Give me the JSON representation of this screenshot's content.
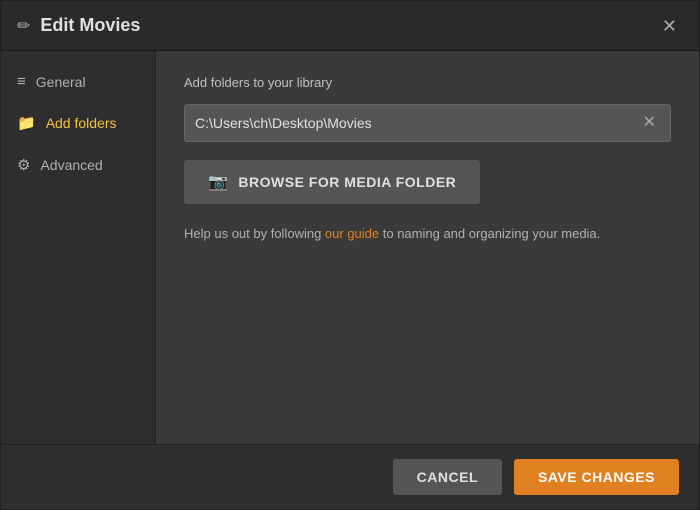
{
  "dialog": {
    "title": "Edit Movies",
    "title_icon": "✏",
    "close_icon": "✕"
  },
  "sidebar": {
    "items": [
      {
        "id": "general",
        "label": "General",
        "icon": "≡",
        "active": false
      },
      {
        "id": "add-folders",
        "label": "Add folders",
        "icon": "📁",
        "active": true
      },
      {
        "id": "advanced",
        "label": "Advanced",
        "icon": "⚙",
        "active": false
      }
    ]
  },
  "main": {
    "section_label": "Add folders to your library",
    "folder_path": "C:\\Users\\ch\\Desktop\\Movies",
    "clear_icon": "✕",
    "browse_button_label": "BROWSE FOR MEDIA FOLDER",
    "browse_icon": "📷",
    "guide_text_before": "Help us out by following ",
    "guide_link_label": "our guide",
    "guide_text_after": " to naming and organizing your media."
  },
  "footer": {
    "cancel_label": "CANCEL",
    "save_label": "SAVE CHANGES"
  }
}
